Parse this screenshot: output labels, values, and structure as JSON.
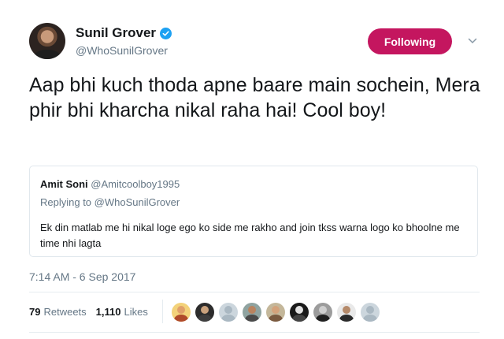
{
  "author": {
    "display_name": "Sunil Grover",
    "handle": "@WhoSunilGrover",
    "verified": true
  },
  "follow_button": {
    "label": "Following",
    "color": "#c4165f"
  },
  "tweet": {
    "text": "Aap bhi kuch thoda apne baare main sochein, Mera phir bhi kharcha nikal raha hai! Cool boy!"
  },
  "quoted": {
    "name": "Amit Soni",
    "handle": "@Amitcoolboy1995",
    "replying_to": "Replying to @WhoSunilGrover",
    "text": "Ek din matlab me hi nikal loge ego ko side me rakho and join tkss warna logo ko bhoolne me time nhi lagta"
  },
  "timestamp": "7:14 AM - 6 Sep 2017",
  "stats": {
    "retweets_count": "79",
    "retweets_label": "Retweets",
    "likes_count": "1,110",
    "likes_label": "Likes"
  },
  "likers": [
    {
      "head": "#e0a06a",
      "bg": "#f3d27a",
      "body": "#b04a2a"
    },
    {
      "head": "#caa27d",
      "bg": "#2c2c2c",
      "body": "#3e3e3e"
    },
    {
      "head": "#aab8c2",
      "bg": "#ccd6dd",
      "body": "#aab8c2"
    },
    {
      "head": "#b9835f",
      "bg": "#8fa3a0",
      "body": "#4a4a4a"
    },
    {
      "head": "#d3a27b",
      "bg": "#c4b79a",
      "body": "#7a5a40"
    },
    {
      "head": "#e2e2e2",
      "bg": "#1a1a1a",
      "body": "#444444"
    },
    {
      "head": "#cfcfcf",
      "bg": "#9c9c9c",
      "body": "#202020"
    },
    {
      "head": "#b58a6a",
      "bg": "#e9e9e9",
      "body": "#2a2a2a"
    },
    {
      "head": "#aab8c2",
      "bg": "#ccd6dd",
      "body": "#aab8c2"
    }
  ]
}
